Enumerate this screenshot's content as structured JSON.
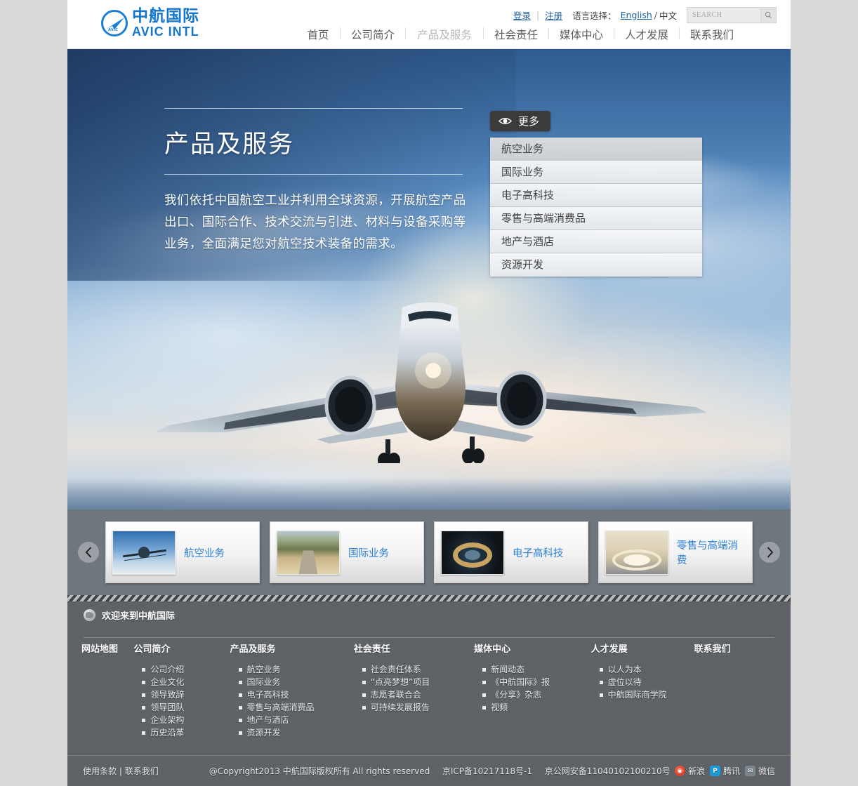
{
  "brand": {
    "logo_cn": "中航国际",
    "logo_en": "AVIC  INTL",
    "logo_micro": "AVIC"
  },
  "utility": {
    "login": "登录",
    "separator": "|",
    "register": "注册",
    "language_label": "语言选择：",
    "lang_en": "English",
    "lang_slash": "/",
    "lang_cn": "中文",
    "search_placeholder": "SEARCH",
    "search_value": ""
  },
  "nav": {
    "items": [
      {
        "label": "首页",
        "active": false
      },
      {
        "label": "公司简介",
        "active": false
      },
      {
        "label": "产品及服务",
        "active": true
      },
      {
        "label": "社会责任",
        "active": false
      },
      {
        "label": "媒体中心",
        "active": false
      },
      {
        "label": "人才发展",
        "active": false
      },
      {
        "label": "联系我们",
        "active": false
      }
    ]
  },
  "hero": {
    "title": "产品及服务",
    "description": "我们依托中国航空工业并利用全球资源，开展航空产品出口、国际合作、技术交流与引进、材料与设备采购等业务，全面满足您对航空技术装备的需求。",
    "more_label": "更多",
    "more_icon": "eye-icon",
    "submenu": [
      "航空业务",
      "国际业务",
      "电子高科技",
      "零售与高端消费品",
      "地产与酒店",
      "资源开发"
    ]
  },
  "carousel": {
    "prev_icon": "chevron-left-icon",
    "next_icon": "chevron-right-icon",
    "cards": [
      {
        "label": "航空业务",
        "thumb": "airplane-thumb"
      },
      {
        "label": "国际业务",
        "thumb": "road-thumb"
      },
      {
        "label": "电子高科技",
        "thumb": "turbine-thumb"
      },
      {
        "label": "零售与高端消费",
        "thumb": "mall-thumb"
      }
    ]
  },
  "footer": {
    "welcome": "欢迎来到中航国际",
    "welcome_icon": "globe-icon",
    "sitemap_label": "网站地图",
    "columns": [
      {
        "head": "公司简介",
        "items": [
          "公司介绍",
          "企业文化",
          "领导致辞",
          "领导团队",
          "企业架构",
          "历史沿革"
        ]
      },
      {
        "head": "产品及服务",
        "items": [
          "航空业务",
          "国际业务",
          "电子高科技",
          "零售与高端消费品",
          "地产与酒店",
          "资源开发"
        ]
      },
      {
        "head": "社会责任",
        "items": [
          "社会责任体系",
          "“点亮梦想”项目",
          "志愿者联合会",
          "可持续发展报告"
        ]
      },
      {
        "head": "媒体中心",
        "items": [
          "新闻动态",
          "《中航国际》报",
          "《分享》杂志",
          "视频"
        ]
      },
      {
        "head": "人才发展",
        "items": [
          "以人为本",
          "虚位以待",
          "中航国际商学院"
        ]
      },
      {
        "head": "联系我们",
        "items": []
      }
    ],
    "bottom": {
      "terms": "使用条款",
      "divider": "|",
      "contact": "联系我们",
      "copyright": "@Copyright2013 中航国际版权所有 All rights reserved",
      "icp": "京ICP备10217118号-1",
      "police": "京公网安备11040102100210号",
      "social": [
        {
          "name": "新浪",
          "icon": "weibo-icon",
          "color": "#d62b18"
        },
        {
          "name": "腾讯",
          "icon": "qq-icon",
          "color": "#1a9ad6"
        },
        {
          "name": "微信",
          "icon": "wechat-icon",
          "color": "#7b868c"
        }
      ]
    }
  },
  "colors": {
    "brand_blue": "#1477cd",
    "link_blue": "#2b7fd4",
    "footer_bg": "#5b5f63",
    "carousel_bg": "#6f767d"
  }
}
